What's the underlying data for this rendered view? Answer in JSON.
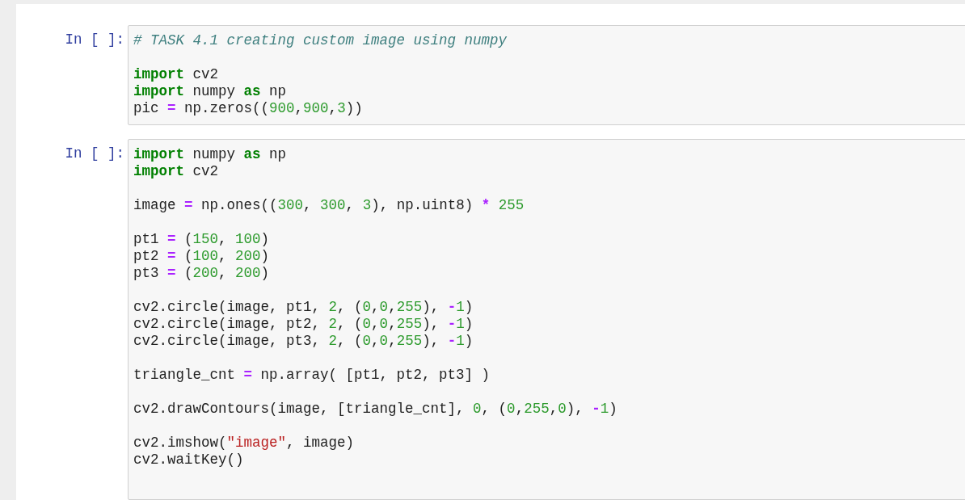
{
  "cells": [
    {
      "prompt": "In [ ]:",
      "blocks": [
        [
          [
            {
              "kind": "comment",
              "text": "# TASK 4.1 creating custom image using numpy"
            }
          ]
        ],
        [
          [
            {
              "kind": "keyword",
              "text": "import"
            },
            {
              "kind": "plain",
              "text": " cv2"
            }
          ],
          [
            {
              "kind": "keyword",
              "text": "import"
            },
            {
              "kind": "plain",
              "text": " numpy "
            },
            {
              "kind": "keyword",
              "text": "as"
            },
            {
              "kind": "plain",
              "text": " np"
            }
          ],
          [
            {
              "kind": "plain",
              "text": "pic "
            },
            {
              "kind": "operator",
              "text": "="
            },
            {
              "kind": "plain",
              "text": " np.zeros(("
            },
            {
              "kind": "number",
              "text": "900"
            },
            {
              "kind": "plain",
              "text": ","
            },
            {
              "kind": "number",
              "text": "900"
            },
            {
              "kind": "plain",
              "text": ","
            },
            {
              "kind": "number",
              "text": "3"
            },
            {
              "kind": "plain",
              "text": "))"
            }
          ]
        ]
      ]
    },
    {
      "prompt": "In [ ]:",
      "blocks": [
        [
          [
            {
              "kind": "keyword",
              "text": "import"
            },
            {
              "kind": "plain",
              "text": " numpy "
            },
            {
              "kind": "keyword",
              "text": "as"
            },
            {
              "kind": "plain",
              "text": " np"
            }
          ],
          [
            {
              "kind": "keyword",
              "text": "import"
            },
            {
              "kind": "plain",
              "text": " cv2"
            }
          ]
        ],
        [
          [
            {
              "kind": "plain",
              "text": "image "
            },
            {
              "kind": "operator",
              "text": "="
            },
            {
              "kind": "plain",
              "text": " np.ones(("
            },
            {
              "kind": "number",
              "text": "300"
            },
            {
              "kind": "plain",
              "text": ", "
            },
            {
              "kind": "number",
              "text": "300"
            },
            {
              "kind": "plain",
              "text": ", "
            },
            {
              "kind": "number",
              "text": "3"
            },
            {
              "kind": "plain",
              "text": "), np.uint8) "
            },
            {
              "kind": "operator",
              "text": "* "
            },
            {
              "kind": "number",
              "text": "255"
            }
          ]
        ],
        [
          [
            {
              "kind": "plain",
              "text": "pt1 "
            },
            {
              "kind": "operator",
              "text": "="
            },
            {
              "kind": "plain",
              "text": " ("
            },
            {
              "kind": "number",
              "text": "150"
            },
            {
              "kind": "plain",
              "text": ", "
            },
            {
              "kind": "number",
              "text": "100"
            },
            {
              "kind": "plain",
              "text": ")"
            }
          ],
          [
            {
              "kind": "plain",
              "text": "pt2 "
            },
            {
              "kind": "operator",
              "text": "="
            },
            {
              "kind": "plain",
              "text": " ("
            },
            {
              "kind": "number",
              "text": "100"
            },
            {
              "kind": "plain",
              "text": ", "
            },
            {
              "kind": "number",
              "text": "200"
            },
            {
              "kind": "plain",
              "text": ")"
            }
          ],
          [
            {
              "kind": "plain",
              "text": "pt3 "
            },
            {
              "kind": "operator",
              "text": "="
            },
            {
              "kind": "plain",
              "text": " ("
            },
            {
              "kind": "number",
              "text": "200"
            },
            {
              "kind": "plain",
              "text": ", "
            },
            {
              "kind": "number",
              "text": "200"
            },
            {
              "kind": "plain",
              "text": ")"
            }
          ]
        ],
        [
          [
            {
              "kind": "plain",
              "text": "cv2.circle(image, pt1, "
            },
            {
              "kind": "number",
              "text": "2"
            },
            {
              "kind": "plain",
              "text": ", ("
            },
            {
              "kind": "number",
              "text": "0"
            },
            {
              "kind": "plain",
              "text": ","
            },
            {
              "kind": "number",
              "text": "0"
            },
            {
              "kind": "plain",
              "text": ","
            },
            {
              "kind": "number",
              "text": "255"
            },
            {
              "kind": "plain",
              "text": "), "
            },
            {
              "kind": "operator",
              "text": "-"
            },
            {
              "kind": "number",
              "text": "1"
            },
            {
              "kind": "plain",
              "text": ")"
            }
          ],
          [
            {
              "kind": "plain",
              "text": "cv2.circle(image, pt2, "
            },
            {
              "kind": "number",
              "text": "2"
            },
            {
              "kind": "plain",
              "text": ", ("
            },
            {
              "kind": "number",
              "text": "0"
            },
            {
              "kind": "plain",
              "text": ","
            },
            {
              "kind": "number",
              "text": "0"
            },
            {
              "kind": "plain",
              "text": ","
            },
            {
              "kind": "number",
              "text": "255"
            },
            {
              "kind": "plain",
              "text": "), "
            },
            {
              "kind": "operator",
              "text": "-"
            },
            {
              "kind": "number",
              "text": "1"
            },
            {
              "kind": "plain",
              "text": ")"
            }
          ],
          [
            {
              "kind": "plain",
              "text": "cv2.circle(image, pt3, "
            },
            {
              "kind": "number",
              "text": "2"
            },
            {
              "kind": "plain",
              "text": ", ("
            },
            {
              "kind": "number",
              "text": "0"
            },
            {
              "kind": "plain",
              "text": ","
            },
            {
              "kind": "number",
              "text": "0"
            },
            {
              "kind": "plain",
              "text": ","
            },
            {
              "kind": "number",
              "text": "255"
            },
            {
              "kind": "plain",
              "text": "), "
            },
            {
              "kind": "operator",
              "text": "-"
            },
            {
              "kind": "number",
              "text": "1"
            },
            {
              "kind": "plain",
              "text": ")"
            }
          ]
        ],
        [
          [
            {
              "kind": "plain",
              "text": "triangle_cnt "
            },
            {
              "kind": "operator",
              "text": "="
            },
            {
              "kind": "plain",
              "text": " np.array( [pt1, pt2, pt3] )"
            }
          ]
        ],
        [
          [
            {
              "kind": "plain",
              "text": "cv2.drawContours(image, [triangle_cnt], "
            },
            {
              "kind": "number",
              "text": "0"
            },
            {
              "kind": "plain",
              "text": ", ("
            },
            {
              "kind": "number",
              "text": "0"
            },
            {
              "kind": "plain",
              "text": ","
            },
            {
              "kind": "number",
              "text": "255"
            },
            {
              "kind": "plain",
              "text": ","
            },
            {
              "kind": "number",
              "text": "0"
            },
            {
              "kind": "plain",
              "text": "), "
            },
            {
              "kind": "operator",
              "text": "-"
            },
            {
              "kind": "number",
              "text": "1"
            },
            {
              "kind": "plain",
              "text": ")"
            }
          ]
        ],
        [
          [
            {
              "kind": "plain",
              "text": "cv2.imshow("
            },
            {
              "kind": "string",
              "text": "\"image\""
            },
            {
              "kind": "plain",
              "text": ", image)"
            }
          ],
          [
            {
              "kind": "plain",
              "text": "cv2.waitKey()"
            }
          ]
        ]
      ]
    }
  ]
}
